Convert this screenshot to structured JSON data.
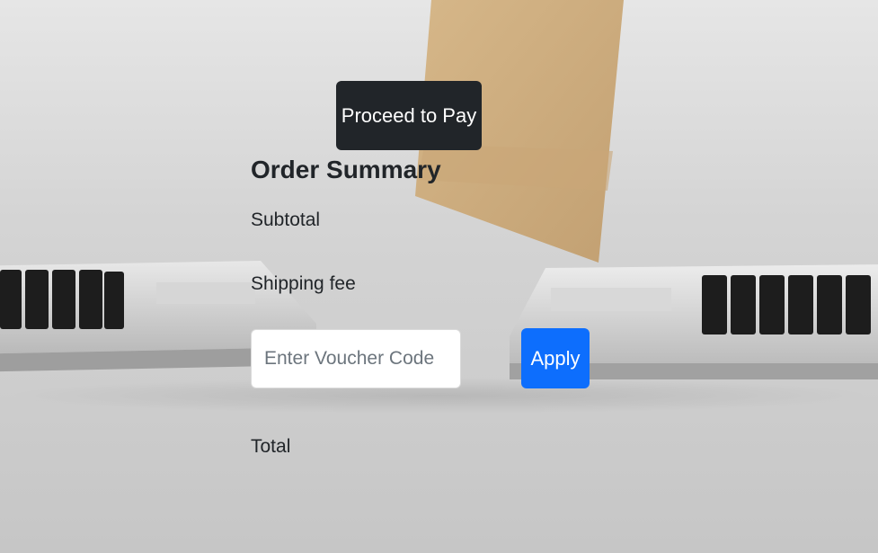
{
  "checkout": {
    "proceed_label": "Proceed to Pay",
    "summary_title": "Order Summary",
    "subtotal_label": "Subtotal",
    "shipping_label": "Shipping fee",
    "voucher_placeholder": "Enter Voucher Code",
    "voucher_value": "",
    "apply_label": "Apply",
    "total_label": "Total"
  },
  "colors": {
    "proceed_button_bg": "#212529",
    "apply_button_bg": "#0d6efd",
    "text": "#212529",
    "placeholder": "#6c757d"
  },
  "background": {
    "image_subject": "parcel-between-laptops"
  }
}
